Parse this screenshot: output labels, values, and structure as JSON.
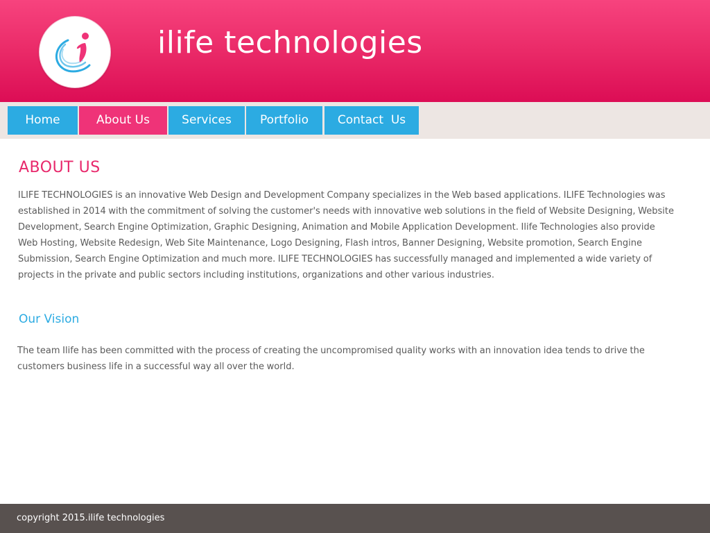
{
  "header": {
    "logo_icon": "ilife-swirl-logo-icon",
    "site_title": "ilife technologies"
  },
  "nav": {
    "items": [
      {
        "label": "Home",
        "active": false
      },
      {
        "label": "About Us",
        "active": true
      },
      {
        "label": "Services",
        "active": false
      },
      {
        "label": "Portfolio",
        "active": false
      },
      {
        "label": "Contact  Us",
        "active": false
      }
    ]
  },
  "content": {
    "title": "ABOUT US",
    "about_text": "ILIFE TECHNOLOGIES is an innovative Web Design and Development Company specializes in the Web based applications. ILIFE Technologies was established in 2014 with the commitment of solving the customer's needs with innovative web solutions in the field of Website Designing, Website Development, Search Engine Optimization, Graphic Designing, Animation and Mobile Application Development. Ilife Technologies also provide Web Hosting, Website Redesign, Web Site Maintenance, Logo Designing, Flash intros, Banner Designing, Website promotion, Search Engine Submission, Search Engine Optimization and much more. ILIFE TECHNOLOGIES has successfully managed and implemented a wide variety of projects in the private and public sectors including institutions, organizations and other various industries.",
    "vision_title": "Our Vision",
    "vision_text": "The team Ilife has been committed with the process of creating the uncompromised quality works with an innovation idea tends to drive the customers business life in a successful way all over the world."
  },
  "footer": {
    "copyright": "copyright 2015.ilife technologies"
  },
  "colors": {
    "header_pink": "#ea2a68",
    "nav_blue": "#2cabe2",
    "nav_active_pink": "#ef3378",
    "navbar_bg": "#ede6e3",
    "title_pink": "#e8286b",
    "footer_bg": "#58514f"
  }
}
